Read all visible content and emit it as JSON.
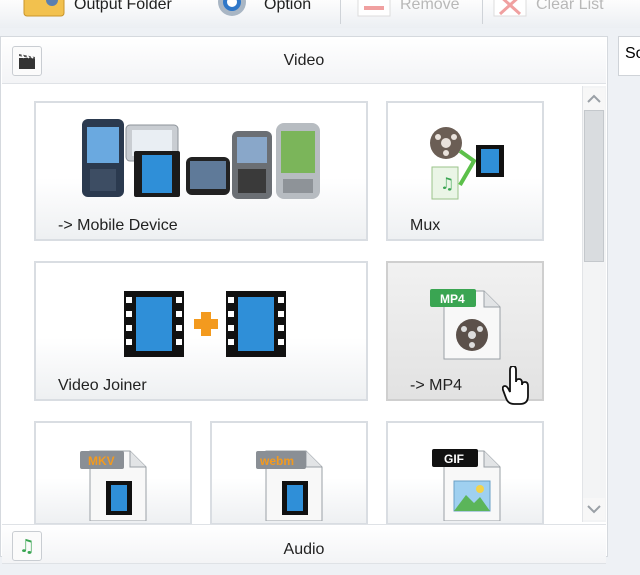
{
  "toolbar": {
    "output_folder_label": "Output Folder",
    "option_label": "Option",
    "remove_label": "Remove",
    "clear_list_label": "Clear List"
  },
  "right_panel": {
    "text": "So"
  },
  "video_section": {
    "title": "Video",
    "tiles": [
      {
        "label": "-> Mobile Device",
        "icon": "mobile-devices-icon"
      },
      {
        "label": "Mux",
        "icon": "mux-icon"
      },
      {
        "label": "Video Joiner",
        "icon": "video-joiner-icon"
      },
      {
        "label": "-> MP4",
        "icon": "mp4-file-icon",
        "badge": "MP4"
      },
      {
        "label": "",
        "icon": "mkv-file-icon",
        "badge": "MKV"
      },
      {
        "label": "",
        "icon": "webm-file-icon",
        "badge": "webm"
      },
      {
        "label": "",
        "icon": "gif-file-icon",
        "badge": "GIF"
      }
    ]
  },
  "audio_section": {
    "title": "Audio"
  },
  "colors": {
    "accent_orange": "#f39a1e",
    "film_blue": "#2f8fd8",
    "mp4_green": "#3aa552"
  }
}
